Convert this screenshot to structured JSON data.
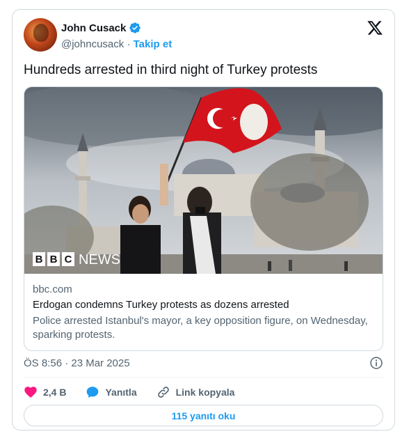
{
  "author": {
    "name": "John Cusack",
    "handle": "@johncusack",
    "separator": "·",
    "follow_label": "Takip et"
  },
  "tweet": {
    "text": "Hundreds arrested in third night of Turkey protests"
  },
  "media": {
    "brand_overlay": "BBC NEWS",
    "brand_letters": [
      "B",
      "B",
      "C"
    ],
    "brand_word": "NEWS"
  },
  "link_card": {
    "domain": "bbc.com",
    "title": "Erdogan condemns Turkey protests as dozens arrested",
    "description": "Police arrested Istanbul's mayor, a key opposition figure, on Wednesday, sparking protests."
  },
  "timestamp": "ÖS 8:56 · 23 Mar 2025",
  "actions": {
    "likes": "2,4 B",
    "reply_label": "Yanıtla",
    "copy_link_label": "Link kopyala"
  },
  "read_replies_label": "115 yanıtı oku",
  "icons": {
    "verified": "verified-badge-icon",
    "platform": "x-logo-icon",
    "info": "info-icon",
    "like": "heart-icon",
    "reply": "speech-bubble-icon",
    "link": "chain-link-icon"
  },
  "colors": {
    "accent": "#1d9bf0",
    "like": "#f91880",
    "text_primary": "#0f1419",
    "text_secondary": "#536471",
    "border": "#cfd9de"
  }
}
